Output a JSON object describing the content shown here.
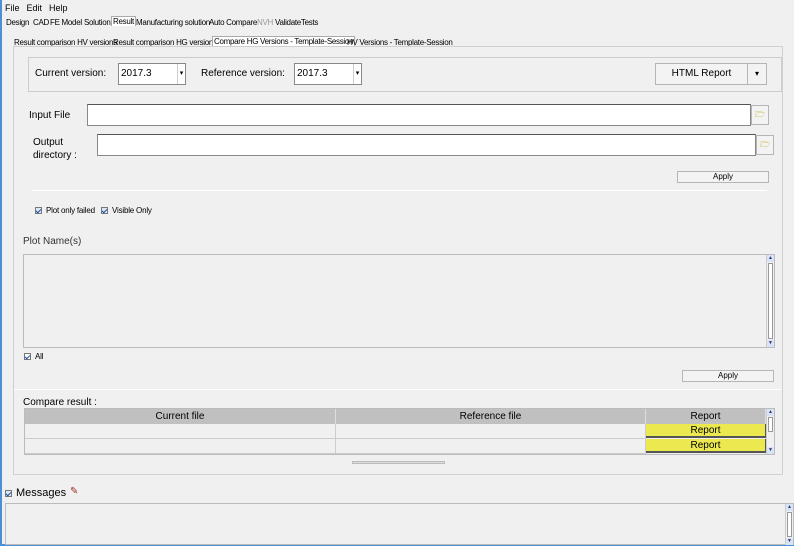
{
  "menu": [
    "File",
    "Edit",
    "Help"
  ],
  "main_tabs": [
    "Design",
    "CAD",
    "FE Model",
    "Solution",
    "Result",
    "Manufacturing solution",
    "Auto Compare",
    "NVH",
    "ValidateTests"
  ],
  "sub_tabs": [
    "Result comparison HV versions",
    "Result comparison HG versions",
    "Compare HG Versions - Template-Session",
    "HV Versions - Template-Session"
  ],
  "versions": {
    "current_label": "Current version:",
    "current_value": "2017.3",
    "reference_label": "Reference version:",
    "reference_value": "2017.3",
    "report_button": "HTML Report",
    "report_menu_arrow": "▾"
  },
  "input_file": {
    "label": "Input File",
    "value": ""
  },
  "output_dir": {
    "label_line1": "Output",
    "label_line2": "directory :",
    "value": ""
  },
  "apply_top": "Apply",
  "options": {
    "plot_only_failed": "Plot only failed",
    "visible_only": "Visible Only"
  },
  "plot_names": {
    "label": "Plot Name(s)",
    "all_label": "All",
    "apply": "Apply"
  },
  "compare": {
    "label": "Compare result :",
    "columns": [
      "Current file",
      "Reference file",
      "Report"
    ],
    "rows": [
      {
        "current": "",
        "reference": "",
        "report": "Report"
      },
      {
        "current": "",
        "reference": "",
        "report": "Report"
      }
    ]
  },
  "messages": {
    "label": "Messages"
  },
  "colors": {
    "report_cell": "#ece950",
    "header": "#c0c0c0"
  }
}
